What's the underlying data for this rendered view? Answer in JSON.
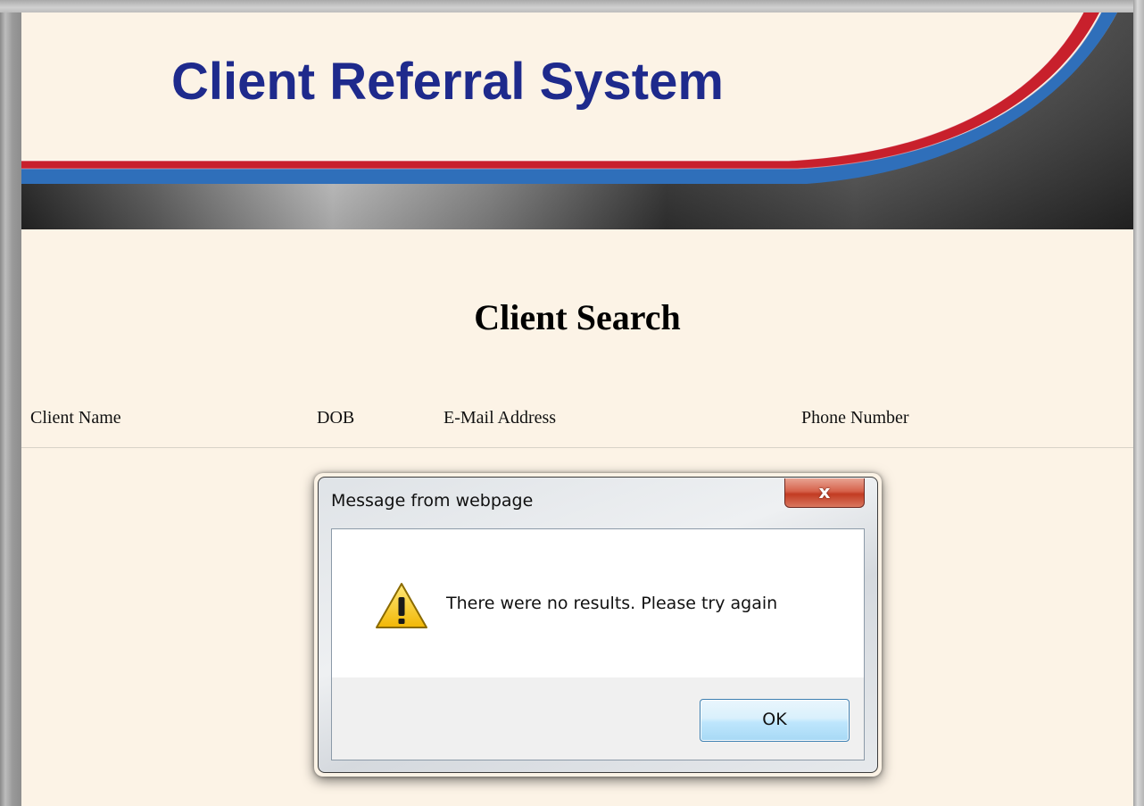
{
  "app": {
    "title": "Client Referral System"
  },
  "page": {
    "heading": "Client Search"
  },
  "results_table": {
    "columns": [
      "Client Name",
      "DOB",
      "E-Mail Address",
      "Phone Number"
    ],
    "rows": []
  },
  "dialog": {
    "title": "Message from webpage",
    "close_icon": "close-icon",
    "close_glyph": "x",
    "icon": "warning-icon",
    "message": "There were no results.  Please try again",
    "ok_label": "OK"
  },
  "colors": {
    "page_background": "#fcf3e6",
    "title_blue": "#1e2a8c",
    "stripe_red": "#c8202c",
    "stripe_blue": "#2f6fba",
    "close_button_red": "#c23b22",
    "ok_button_blue": "#bee6fd"
  }
}
